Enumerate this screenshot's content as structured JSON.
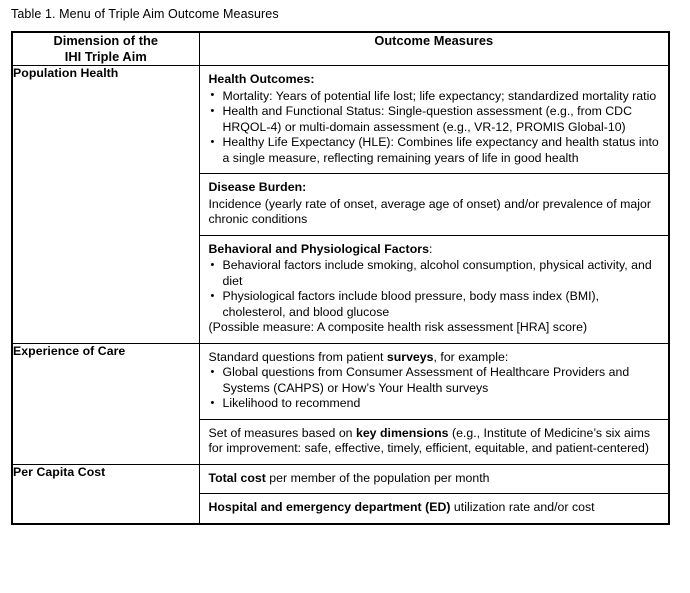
{
  "caption": "Table 1. Menu of Triple Aim Outcome Measures",
  "table": {
    "headers": {
      "col1_line1": "Dimension of the",
      "col1_line2": "IHI Triple Aim",
      "col2": "Outcome Measures"
    },
    "rows": [
      {
        "dimension": "Population Health",
        "blocks": [
          {
            "title": "Health Outcomes:",
            "bullets": [
              "Mortality: Years of potential life lost; life expectancy; standardized mortality ratio",
              "Health and Functional Status: Single-question assessment (e.g., from CDC HRQOL-4) or multi-domain assessment (e.g., VR-12, PROMIS Global-10)",
              "Healthy Life Expectancy (HLE): Combines life expectancy and health status into a single measure, reflecting remaining years of life in good health"
            ],
            "trailing": ""
          },
          {
            "title": "Disease Burden:",
            "bullets": [],
            "body": "Incidence (yearly rate of onset, average age of onset) and/or prevalence of major chronic conditions",
            "trailing": ""
          },
          {
            "title_pre": "Behavioral and Physiological Factors",
            "title_post": ":",
            "bullets": [
              "Behavioral factors include smoking, alcohol consumption, physical activity, and diet",
              "Physiological factors include blood pressure, body mass index (BMI), cholesterol, and blood glucose"
            ],
            "trailing": "(Possible measure: A composite health risk assessment [HRA] score)"
          }
        ]
      },
      {
        "dimension": "Experience of Care",
        "blocks": [
          {
            "lead_pre": "Standard questions from patient ",
            "lead_bold": "surveys",
            "lead_post": ", for example:",
            "bullets": [
              "Global questions from Consumer Assessment of Healthcare Providers and Systems (CAHPS) or How’s Your Health surveys",
              "Likelihood to recommend"
            ]
          },
          {
            "lead_pre": "Set of measures based on ",
            "lead_bold": "key dimensions",
            "lead_post": " (e.g., Institute of Medicine’s six aims for improvement: safe, effective, timely, efficient, equitable, and patient-centered)"
          }
        ]
      },
      {
        "dimension": "Per Capita Cost",
        "blocks": [
          {
            "lead_bold": "Total cost",
            "lead_post": " per member of the population per month"
          },
          {
            "lead_bold": "Hospital and emergency department (ED)",
            "lead_post": " utilization rate and/or cost"
          }
        ]
      }
    ]
  }
}
